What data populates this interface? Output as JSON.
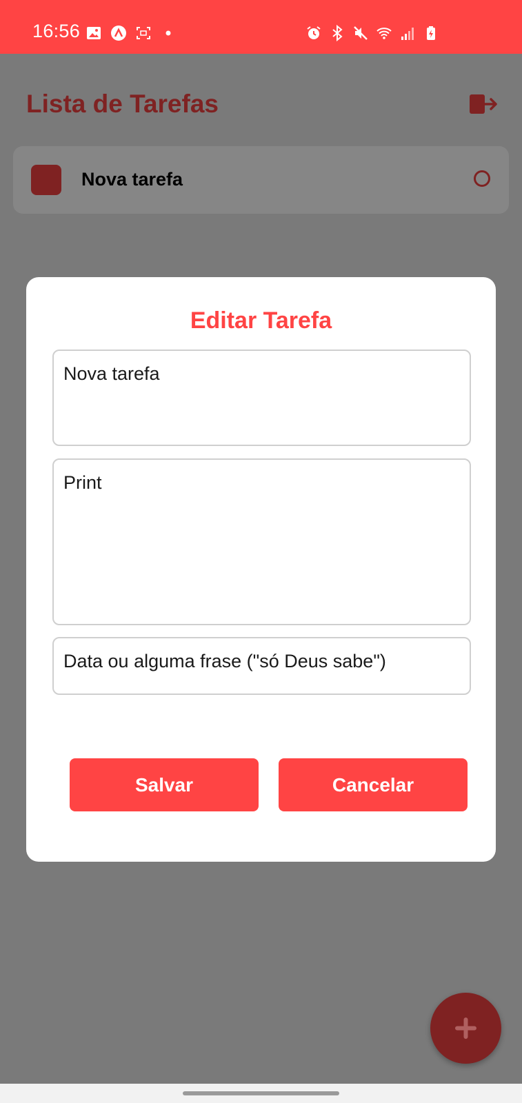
{
  "status_bar": {
    "time": "16:56",
    "left_icons": [
      "image-icon",
      "app-notification-icon",
      "screenshot-icon",
      "dot-icon"
    ],
    "right_icons": [
      "alarm-icon",
      "bluetooth-icon",
      "mute-icon",
      "wifi-icon",
      "signal-icon",
      "battery-charging-icon"
    ],
    "color": "#ff4444"
  },
  "header": {
    "title": "Lista de Tarefas",
    "logout_icon": "logout-icon"
  },
  "tasks": [
    {
      "label": "Nova tarefa",
      "status_text": "O"
    }
  ],
  "modal": {
    "title": "Editar Tarefa",
    "title_field_value": "Nova tarefa",
    "description_field_value": "Print",
    "date_field_value": "Data ou alguma frase (\"só Deus sabe\")",
    "save_label": "Salvar",
    "cancel_label": "Cancelar"
  },
  "fab": {
    "icon": "plus-icon"
  },
  "colors": {
    "accent": "#ff4444",
    "accent_dark": "#7f2222",
    "overlay": "#7a7a7a"
  }
}
